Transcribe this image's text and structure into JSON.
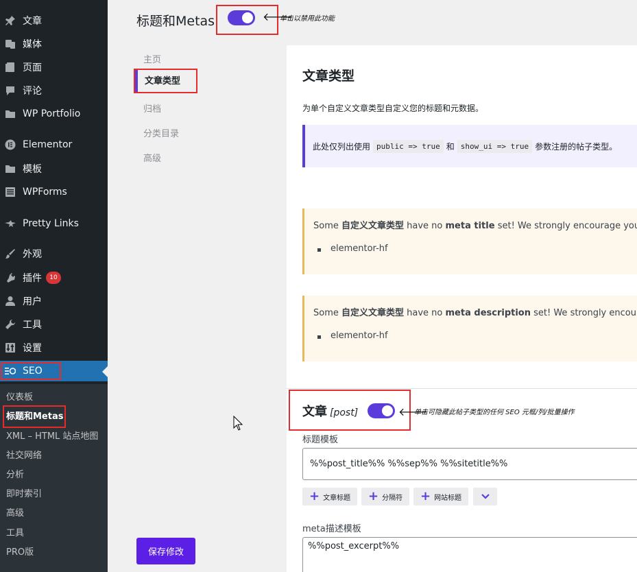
{
  "sidebar": {
    "items": [
      {
        "label": "文章",
        "icon": "pin-icon"
      },
      {
        "label": "媒体",
        "icon": "media-icon"
      },
      {
        "label": "页面",
        "icon": "page-icon"
      },
      {
        "label": "评论",
        "icon": "comment-icon"
      },
      {
        "label": "WP Portfolio",
        "icon": "folder-icon"
      },
      {
        "label": "Elementor",
        "icon": "elementor-icon"
      },
      {
        "label": "模板",
        "icon": "folder-icon"
      },
      {
        "label": "WPForms",
        "icon": "form-icon"
      },
      {
        "label": "Pretty Links",
        "icon": "star-link-icon"
      },
      {
        "label": "外观",
        "icon": "brush-icon"
      },
      {
        "label": "插件",
        "icon": "plugin-icon",
        "badge": "10"
      },
      {
        "label": "用户",
        "icon": "user-icon"
      },
      {
        "label": "工具",
        "icon": "wrench-icon"
      },
      {
        "label": "设置",
        "icon": "settings-icon"
      },
      {
        "label": "SEO",
        "icon": "seo-icon"
      }
    ],
    "submenu": [
      "仪表板",
      "标题和Metas",
      "XML – HTML 站点地图",
      "社交网络",
      "分析",
      "即时索引",
      "高级",
      "工具",
      "PRO版",
      "..."
    ]
  },
  "header": {
    "title": "标题和Metas",
    "toggle_on": true,
    "hint": "单击以禁用此功能"
  },
  "nav": {
    "items": [
      "主页",
      "文章类型",
      "归档",
      "分类目录",
      "高级"
    ],
    "active": "文章类型"
  },
  "content": {
    "heading": "文章类型",
    "description": "为单个自定义文章类型自定义您的标题和元数据。",
    "info": {
      "prefix": "此处仅列出使用",
      "code1": "public => true",
      "mid": "和",
      "code2": "show_ui => true",
      "suffix": "参数注册的帖子类型。"
    },
    "warning1": {
      "pre": "Some ",
      "b1": "自定义文章类型",
      "mid": " have no ",
      "b2": "meta title",
      "post": " set! We strongly encourage you to",
      "item": "elementor-hf"
    },
    "warning2": {
      "pre": "Some ",
      "b1": "自定义文章类型",
      "mid": " have no ",
      "b2": "meta description",
      "post": " set! We strongly encourage",
      "item": "elementor-hf"
    },
    "post_type": {
      "name": "文章",
      "slug": "[post]",
      "toggle_on": true,
      "hint": "单击可隐藏此帖子类型的任何 SEO 元框/列/批量操作",
      "title_label": "标题模板",
      "title_value": "%%post_title%% %%sep%% %%sitetitle%%",
      "tags": [
        "文章标题",
        "分隔符",
        "网站标题"
      ],
      "desc_label": "meta描述模板",
      "desc_value": "%%post_excerpt%%"
    }
  },
  "save_button": "保存修改",
  "colors": {
    "accent": "#5b3cdb",
    "wp_blue": "#2271b1",
    "highlight": "#e52b2b"
  }
}
